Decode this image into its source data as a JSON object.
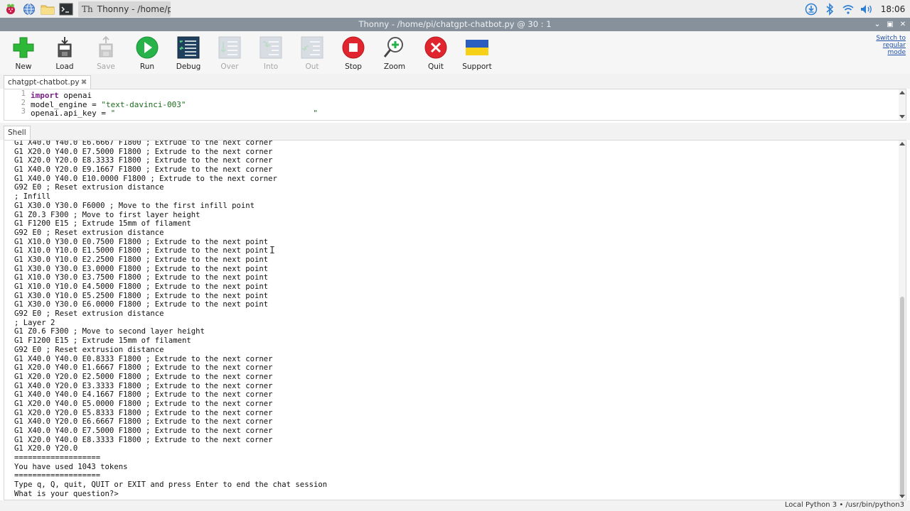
{
  "taskbar": {
    "icons": [
      "raspberry-icon",
      "browser-icon",
      "folder-icon",
      "terminal-icon"
    ],
    "active_task": "Thonny  -  /home/pi/...",
    "tray_icons": [
      "download-icon",
      "bluetooth-icon",
      "wifi-icon",
      "volume-icon"
    ],
    "clock": "18:06"
  },
  "window": {
    "title": "Thonny  -  /home/pi/chatgpt-chatbot.py  @  30 : 1"
  },
  "toolbar": {
    "buttons": [
      {
        "label": "New",
        "icon": "plus-icon",
        "enabled": true
      },
      {
        "label": "Load",
        "icon": "load-icon",
        "enabled": true
      },
      {
        "label": "Save",
        "icon": "save-icon",
        "enabled": false
      },
      {
        "label": "Run",
        "icon": "run-icon",
        "enabled": true
      },
      {
        "label": "Debug",
        "icon": "debug-icon",
        "enabled": true
      },
      {
        "label": "Over",
        "icon": "step-over-icon",
        "enabled": false
      },
      {
        "label": "Into",
        "icon": "step-into-icon",
        "enabled": false
      },
      {
        "label": "Out",
        "icon": "step-out-icon",
        "enabled": false
      },
      {
        "label": "Stop",
        "icon": "stop-icon",
        "enabled": true
      },
      {
        "label": "Zoom",
        "icon": "zoom-icon",
        "enabled": true
      },
      {
        "label": "Quit",
        "icon": "quit-icon",
        "enabled": true
      },
      {
        "label": "Support",
        "icon": "ukraine-flag-icon",
        "enabled": true
      }
    ],
    "switch_mode": [
      "Switch to",
      "regular",
      "mode"
    ]
  },
  "editor": {
    "tab_label": "chatgpt-chatbot.py",
    "lines": [
      {
        "num": "1",
        "kw": "import",
        "rest": " openai",
        "str": ""
      },
      {
        "num": "2",
        "kw": "",
        "rest": "model_engine = ",
        "str": "\"text-davinci-003\""
      },
      {
        "num": "3",
        "kw": "",
        "rest": "openai.api_key = ",
        "str": "\"                                          \""
      }
    ]
  },
  "shell": {
    "tab_label": "Shell",
    "lines": [
      "G1 X40.0 Y40.0 E6.6667 F1800 ; Extrude to the next corner",
      "G1 X20.0 Y40.0 E7.5000 F1800 ; Extrude to the next corner",
      "G1 X20.0 Y20.0 E8.3333 F1800 ; Extrude to the next corner",
      "G1 X40.0 Y20.0 E9.1667 F1800 ; Extrude to the next corner",
      "G1 X40.0 Y40.0 E10.0000 F1800 ; Extrude to the next corner",
      "G92 E0 ; Reset extrusion distance",
      "; Infill",
      "G1 X30.0 Y30.0 F6000 ; Move to the first infill point",
      "G1 Z0.3 F300 ; Move to first layer height",
      "G1 F1200 E15 ; Extrude 15mm of filament",
      "G92 E0 ; Reset extrusion distance",
      "G1 X10.0 Y30.0 E0.7500 F1800 ; Extrude to the next point",
      "G1 X10.0 Y10.0 E1.5000 F1800 ; Extrude to the next point",
      "G1 X30.0 Y10.0 E2.2500 F1800 ; Extrude to the next point",
      "G1 X30.0 Y30.0 E3.0000 F1800 ; Extrude to the next point",
      "G1 X10.0 Y30.0 E3.7500 F1800 ; Extrude to the next point",
      "G1 X10.0 Y10.0 E4.5000 F1800 ; Extrude to the next point",
      "G1 X30.0 Y10.0 E5.2500 F1800 ; Extrude to the next point",
      "G1 X30.0 Y30.0 E6.0000 F1800 ; Extrude to the next point",
      "G92 E0 ; Reset extrusion distance",
      "; Layer 2",
      "G1 Z0.6 F300 ; Move to second layer height",
      "G1 F1200 E15 ; Extrude 15mm of filament",
      "G92 E0 ; Reset extrusion distance",
      "G1 X40.0 Y40.0 E0.8333 F1800 ; Extrude to the next corner",
      "G1 X20.0 Y40.0 E1.6667 F1800 ; Extrude to the next corner",
      "G1 X20.0 Y20.0 E2.5000 F1800 ; Extrude to the next corner",
      "G1 X40.0 Y20.0 E3.3333 F1800 ; Extrude to the next corner",
      "G1 X40.0 Y40.0 E4.1667 F1800 ; Extrude to the next corner",
      "G1 X20.0 Y40.0 E5.0000 F1800 ; Extrude to the next corner",
      "G1 X20.0 Y20.0 E5.8333 F1800 ; Extrude to the next corner",
      "G1 X40.0 Y20.0 E6.6667 F1800 ; Extrude to the next corner",
      "G1 X40.0 Y40.0 E7.5000 F1800 ; Extrude to the next corner",
      "G1 X20.0 Y40.0 E8.3333 F1800 ; Extrude to the next corner",
      "G1 X20.0 Y20.0",
      "===================",
      "You have used 1043 tokens",
      "===================",
      "Type q, Q, quit, QUIT or EXIT and press Enter to end the chat session",
      "What is your question?>"
    ]
  },
  "status": {
    "interpreter": "Local Python 3  •  /usr/bin/python3"
  },
  "colors": {
    "titlebar": "#87919b",
    "run_green": "#27b24a",
    "stop_red": "#e0252e",
    "keyword": "#7a1f87",
    "string": "#1d6b1d",
    "flag_blue": "#2a5fbf",
    "flag_yellow": "#f7d117"
  }
}
